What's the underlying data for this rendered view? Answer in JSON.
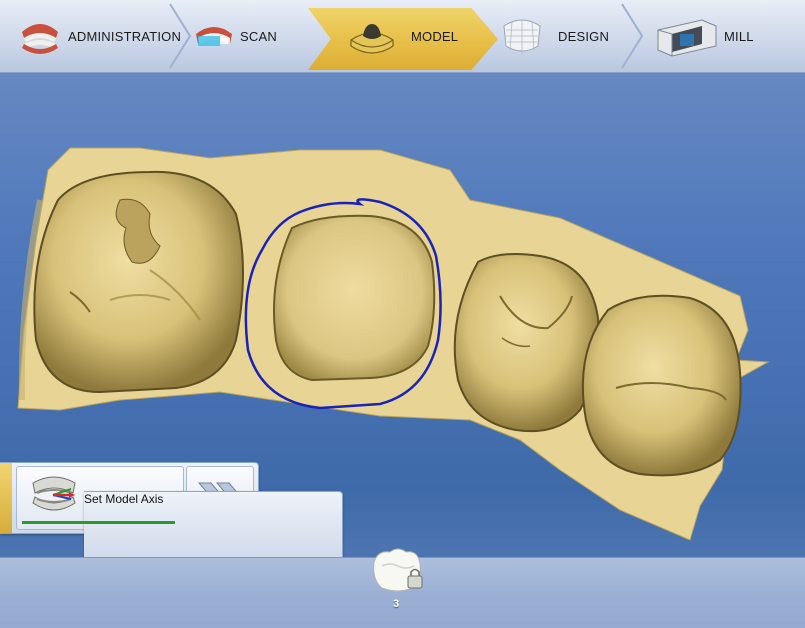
{
  "workflow": {
    "steps": [
      {
        "label": "ADMINISTRATION",
        "icon": "jaw-model-icon"
      },
      {
        "label": "SCAN",
        "icon": "scanned-jaw-icon"
      },
      {
        "label": "MODEL",
        "icon": "model-base-icon",
        "active": true
      },
      {
        "label": "DESIGN",
        "icon": "crown-mesh-icon"
      },
      {
        "label": "MILL",
        "icon": "milling-unit-icon"
      }
    ]
  },
  "phase": {
    "label": "Set Model Axis",
    "progress": 1.0
  },
  "restoration": {
    "tooth_number": "3"
  },
  "colors": {
    "active_step": "#e6bd45",
    "model": "#e8d494",
    "margin_line": "#1a22b8",
    "background": "#4f78bb",
    "progress": "#2a9a2a"
  }
}
